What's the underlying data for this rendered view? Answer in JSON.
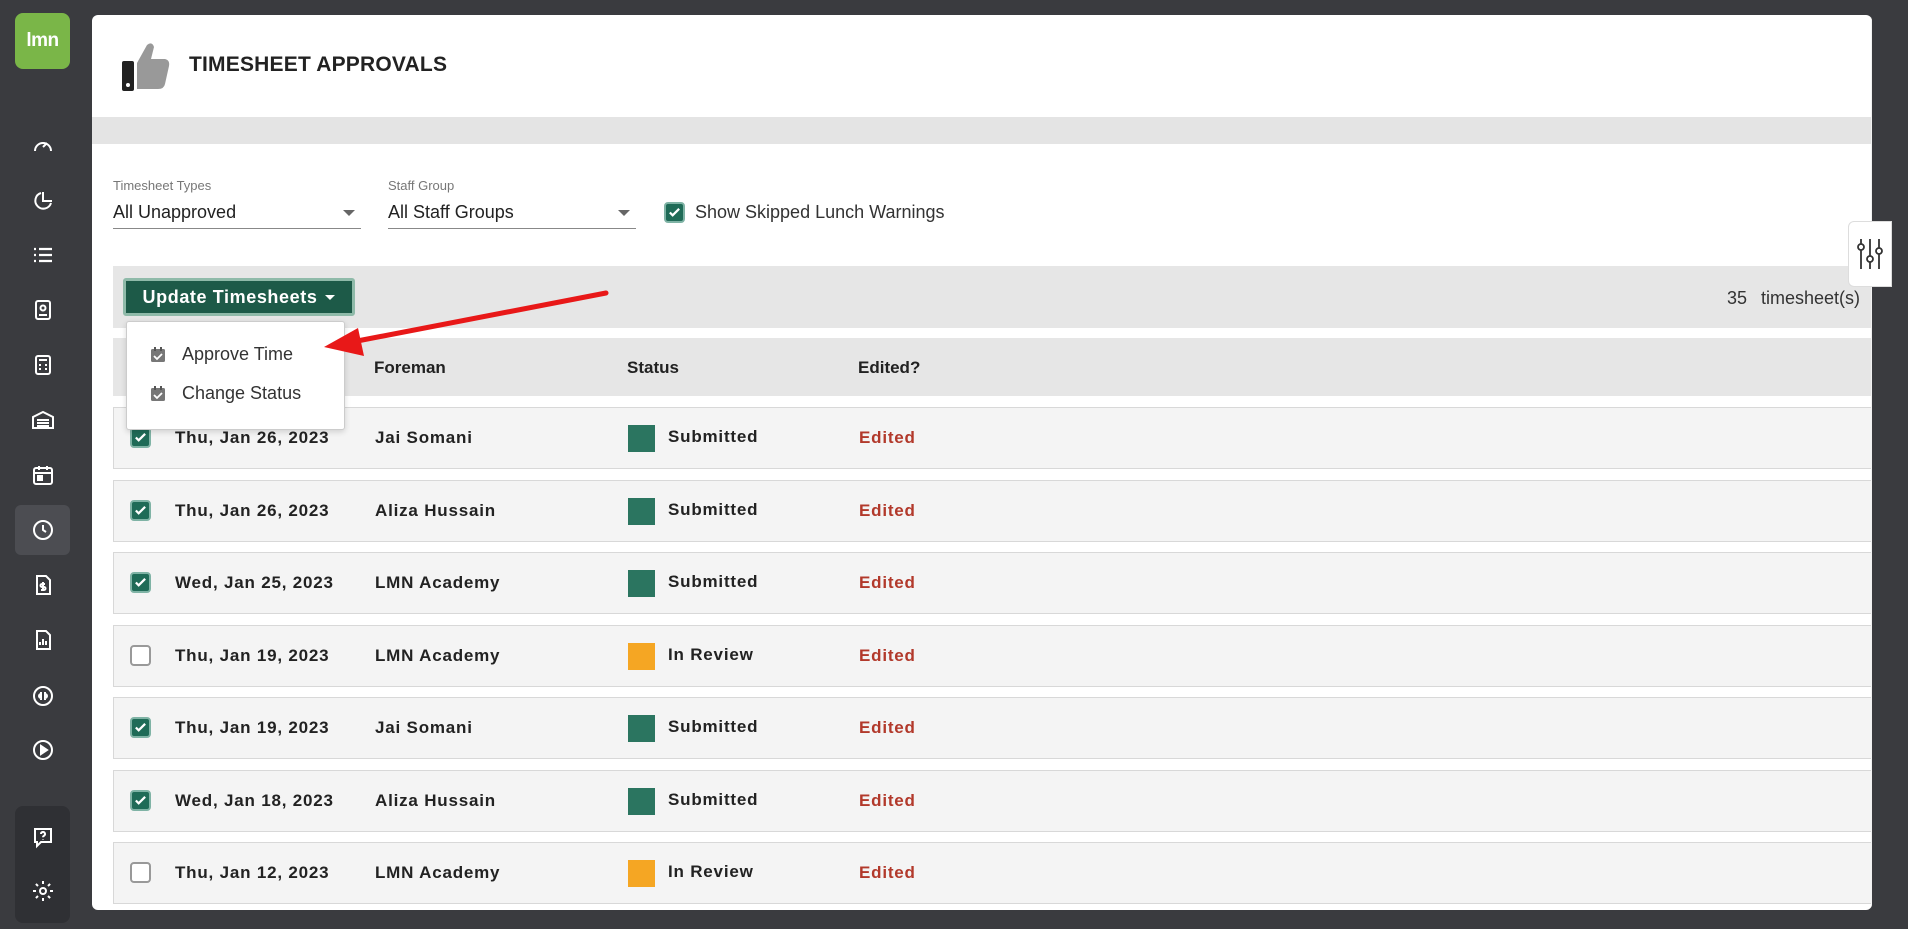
{
  "sidebar": {
    "logo_text": "lmn",
    "brand_color": "#7ab648",
    "items": [
      {
        "icon": "dashboard-gauge-icon"
      },
      {
        "icon": "pie-chart-icon"
      },
      {
        "icon": "list-icon"
      },
      {
        "icon": "contact-card-icon"
      },
      {
        "icon": "calculator-icon"
      },
      {
        "icon": "warehouse-icon"
      },
      {
        "icon": "calendar-icon"
      },
      {
        "icon": "clock-icon",
        "active": true
      },
      {
        "icon": "invoice-dollar-icon"
      },
      {
        "icon": "report-icon"
      },
      {
        "icon": "quickbooks-icon"
      },
      {
        "icon": "play-icon"
      }
    ],
    "bottom_items": [
      {
        "icon": "help-icon"
      },
      {
        "icon": "gear-icon"
      }
    ]
  },
  "header": {
    "title": "TIMESHEET APPROVALS",
    "icon": "thumbs-up-icon"
  },
  "filters": {
    "timesheet_types": {
      "label": "Timesheet Types",
      "value": "All Unapproved"
    },
    "staff_group": {
      "label": "Staff Group",
      "value": "All Staff Groups"
    },
    "skipped_lunch": {
      "label": "Show Skipped Lunch Warnings",
      "checked": true
    }
  },
  "toolbar": {
    "update_label": "Update Timesheets",
    "count": "35",
    "count_label": "timesheet(s)"
  },
  "dropdown": {
    "items": [
      {
        "label": "Approve Time",
        "icon": "calendar-check-icon"
      },
      {
        "label": "Change Status",
        "icon": "calendar-check-icon"
      }
    ]
  },
  "columns": {
    "foreman": "Foreman",
    "status": "Status",
    "edited": "Edited?"
  },
  "status_colors": {
    "Submitted": "#2b7560",
    "In Review": "#f5a623"
  },
  "edited_color": "#b2392b",
  "rows": [
    {
      "checked": true,
      "date": "Thu, Jan 26, 2023",
      "foreman": "Jai Somani",
      "status": "Submitted",
      "edited": "Edited"
    },
    {
      "checked": true,
      "date": "Thu, Jan 26, 2023",
      "foreman": "Aliza Hussain",
      "status": "Submitted",
      "edited": "Edited"
    },
    {
      "checked": true,
      "date": "Wed, Jan 25, 2023",
      "foreman": "LMN Academy",
      "status": "Submitted",
      "edited": "Edited"
    },
    {
      "checked": false,
      "date": "Thu, Jan 19, 2023",
      "foreman": "LMN Academy",
      "status": "In Review",
      "edited": "Edited"
    },
    {
      "checked": true,
      "date": "Thu, Jan 19, 2023",
      "foreman": "Jai Somani",
      "status": "Submitted",
      "edited": "Edited"
    },
    {
      "checked": true,
      "date": "Wed, Jan 18, 2023",
      "foreman": "Aliza Hussain",
      "status": "Submitted",
      "edited": "Edited"
    },
    {
      "checked": false,
      "date": "Thu, Jan 12, 2023",
      "foreman": "LMN Academy",
      "status": "In Review",
      "edited": "Edited"
    }
  ]
}
